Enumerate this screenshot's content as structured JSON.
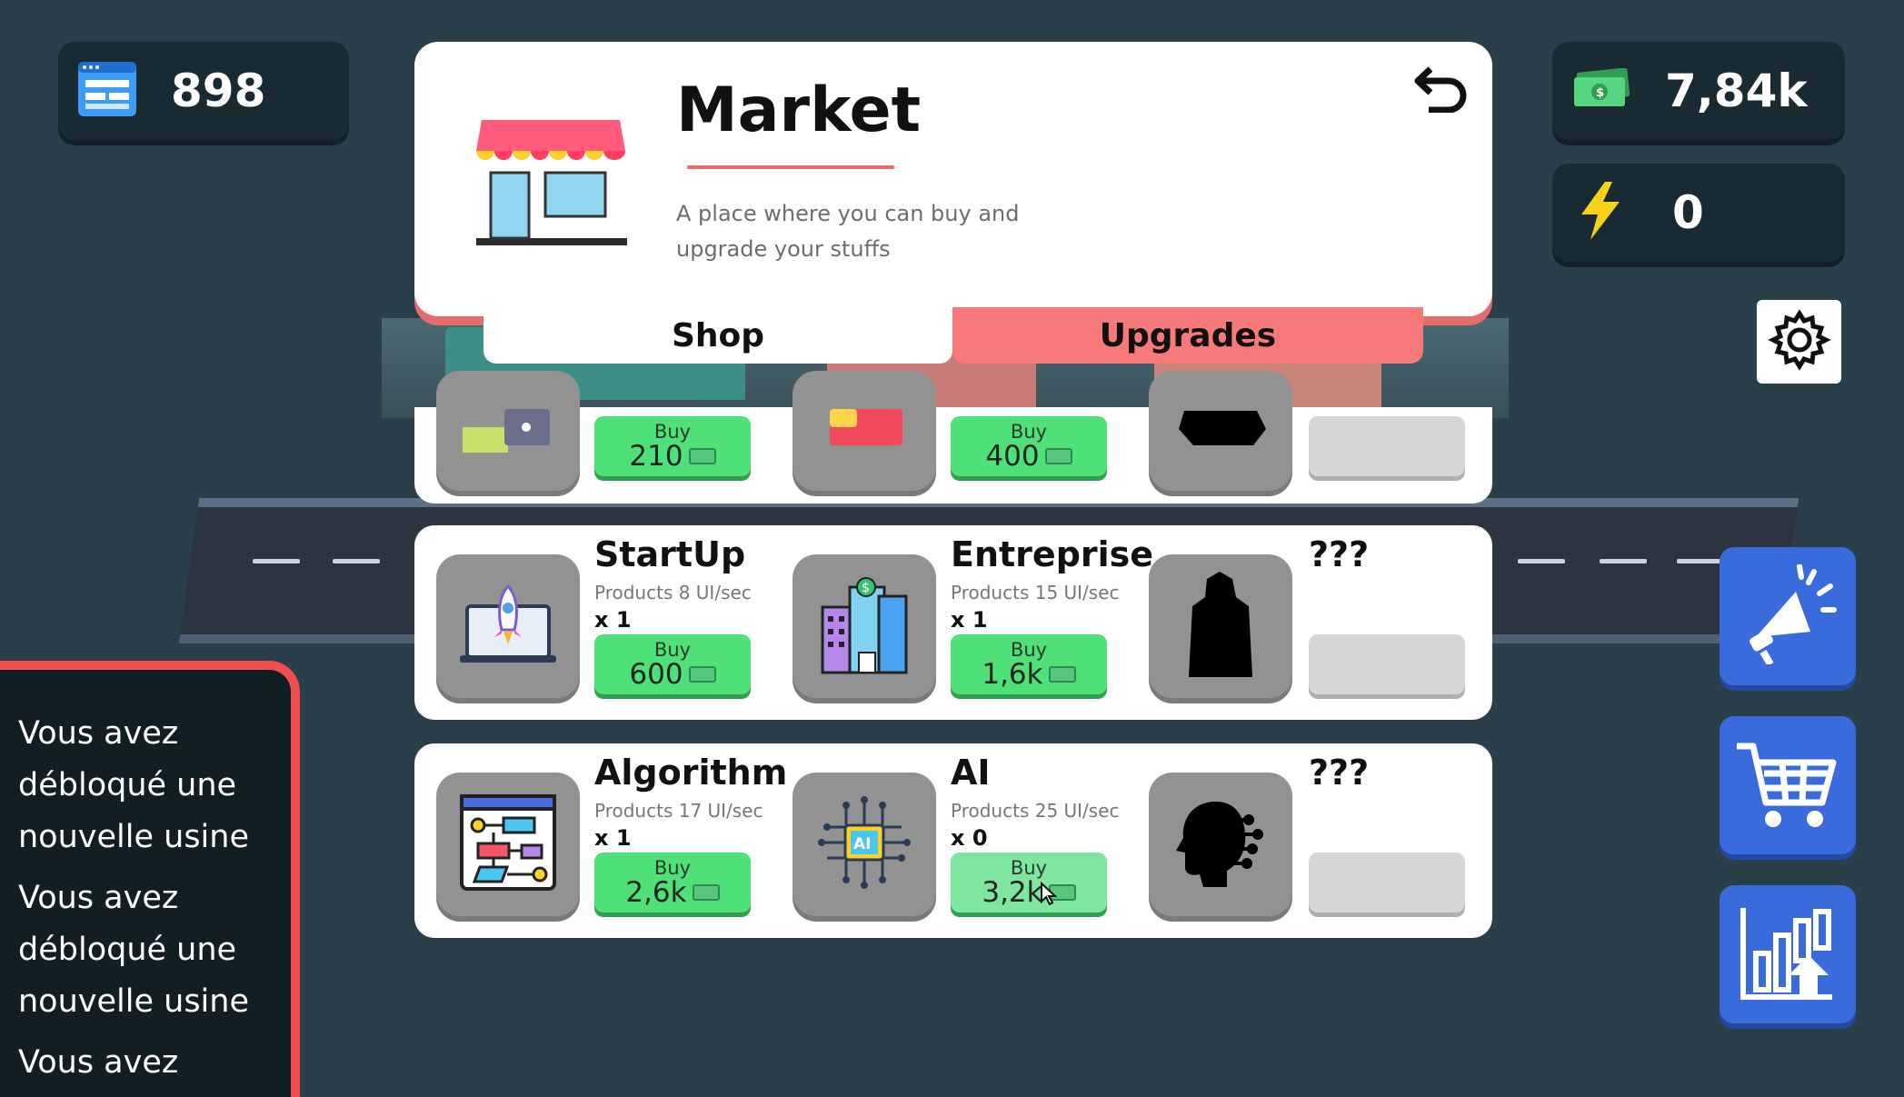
{
  "hud": {
    "ui_count": "898",
    "money": "7,84k",
    "energy": "0"
  },
  "market": {
    "title": "Market",
    "description": "A place where you can buy and upgrade your stuffs",
    "tabs": [
      "Shop",
      "Upgrades"
    ]
  },
  "partial_row": {
    "buy_label": "Buy",
    "prices": [
      "210",
      "400"
    ]
  },
  "factories": [
    {
      "name": "StartUp",
      "products": "Products 8 UI/sec",
      "count": "x 1",
      "buy_label": "Buy",
      "price": "600",
      "icon": "rocket-laptop-icon"
    },
    {
      "name": "Entreprise",
      "products": "Products 15 UI/sec",
      "count": "x 1",
      "buy_label": "Buy",
      "price": "1,6k",
      "icon": "office-buildings-icon"
    },
    {
      "name": "???",
      "locked": true,
      "icon": "locked-tower-silhouette-icon"
    },
    {
      "name": "Algorithm",
      "products": "Products 17 UI/sec",
      "count": "x 1",
      "buy_label": "Buy",
      "price": "2,6k",
      "icon": "flowchart-icon"
    },
    {
      "name": "AI",
      "products": "Products 25 UI/sec",
      "count": "x 0",
      "buy_label": "Buy",
      "price": "3,2k",
      "icon": "ai-chip-icon"
    },
    {
      "name": "???",
      "locked": true,
      "icon": "locked-head-silhouette-icon"
    }
  ],
  "notifications": [
    "Vous avez débloqué une nouvelle usine",
    "Vous avez débloqué une nouvelle usine",
    "Vous avez"
  ],
  "colors": {
    "background": "#2b3f4a",
    "accent_red": "#f87979",
    "buy_green": "#4fe07a",
    "side_blue": "#3a6bdc"
  }
}
